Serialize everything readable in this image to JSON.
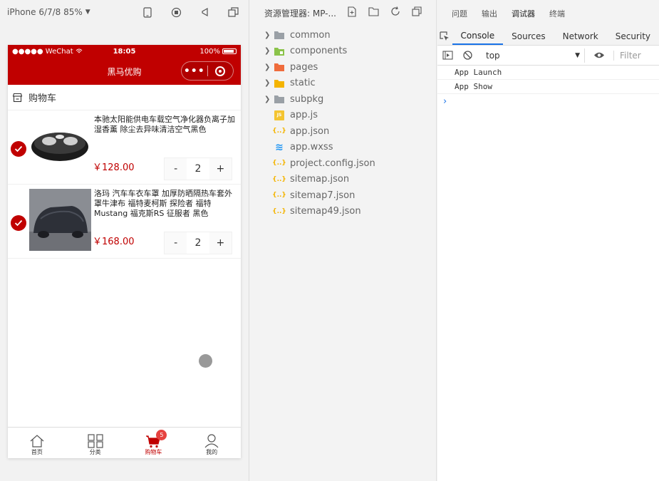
{
  "simulator": {
    "device": "iPhone 6/7/8 85%",
    "statusbar": {
      "carrier": "●●●●● WeChat",
      "time": "18:05",
      "battery": "100%"
    },
    "navbar_title": "黑马优购",
    "capsule_dots": "•••",
    "cart_header": "购物车",
    "goods": [
      {
        "title": "本驰太阳能供电车载空气净化器负离子加湿香薰 除尘去异味清洁空气黑色",
        "price": "￥128.00",
        "count": "2"
      },
      {
        "title": "洛玛 汽车车衣车罩 加厚防晒隔热车套外罩牛津布 福特麦柯斯 探险者 福特Mustang 福克斯RS 征服者 黑色",
        "price": "￥168.00",
        "count": "2"
      }
    ],
    "stepper": {
      "minus": "-",
      "plus": "+"
    },
    "tabbar": [
      {
        "label": "首页"
      },
      {
        "label": "分类"
      },
      {
        "label": "购物车",
        "badge": "5"
      },
      {
        "label": "我的"
      }
    ],
    "accent": "#c00000"
  },
  "explorer": {
    "title": "资源管理器: MP-...",
    "folders": [
      {
        "name": "common",
        "color": "#9aa0a6"
      },
      {
        "name": "components",
        "color": "#8bc34a"
      },
      {
        "name": "pages",
        "color": "#ef6c3c"
      },
      {
        "name": "static",
        "color": "#f4b400"
      },
      {
        "name": "subpkg",
        "color": "#9aa0a6"
      }
    ],
    "files": [
      {
        "name": "app.js",
        "icon": "js-icon",
        "glyph": "JS",
        "color": "#f4c430"
      },
      {
        "name": "app.json",
        "icon": "json-icon",
        "glyph": "{..}",
        "color": "#f4b400"
      },
      {
        "name": "app.wxss",
        "icon": "css-icon",
        "glyph": "≋",
        "color": "#2196f3"
      },
      {
        "name": "project.config.json",
        "icon": "json-icon",
        "glyph": "{..}",
        "color": "#f4b400"
      },
      {
        "name": "sitemap.json",
        "icon": "json-icon",
        "glyph": "{..}",
        "color": "#f4b400"
      },
      {
        "name": "sitemap7.json",
        "icon": "json-icon",
        "glyph": "{..}",
        "color": "#f4b400"
      },
      {
        "name": "sitemap49.json",
        "icon": "json-icon",
        "glyph": "{..}",
        "color": "#f4b400"
      }
    ]
  },
  "devtools": {
    "top_tabs": [
      "问题",
      "输出",
      "调试器",
      "终端"
    ],
    "panel_tabs": [
      "Console",
      "Sources",
      "Network",
      "Security"
    ],
    "context": "top",
    "filter_placeholder": "Filter",
    "logs": [
      "App Launch",
      "App Show"
    ],
    "prompt": "›"
  }
}
